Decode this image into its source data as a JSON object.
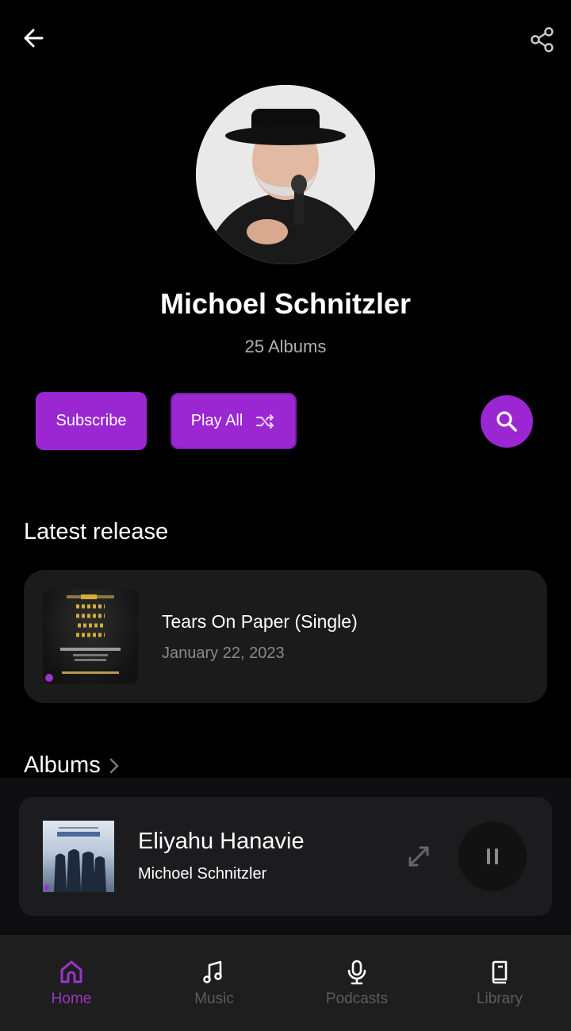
{
  "header": {
    "back_icon": "arrow-left-icon",
    "share_icon": "share-icon"
  },
  "artist": {
    "name": "Michoel Schnitzler",
    "album_count": "25 Albums"
  },
  "actions": {
    "subscribe_label": "Subscribe",
    "play_all_label": "Play All",
    "play_all_icon": "shuffle-icon",
    "search_icon": "search-icon"
  },
  "latest_release": {
    "section_title": "Latest release",
    "title": "Tears On Paper (Single)",
    "date": "January 22, 2023"
  },
  "albums": {
    "section_title": "Albums"
  },
  "now_playing": {
    "title": "Eliyahu Hanavie",
    "artist": "Michoel Schnitzler",
    "state": "playing"
  },
  "nav": {
    "items": [
      {
        "label": "Home",
        "icon": "home-icon",
        "active": true
      },
      {
        "label": "Music",
        "icon": "music-note-icon",
        "active": false
      },
      {
        "label": "Podcasts",
        "icon": "microphone-icon",
        "active": false
      },
      {
        "label": "Library",
        "icon": "book-icon",
        "active": false
      }
    ]
  },
  "colors": {
    "accent": "#9b27d3",
    "background": "#000000",
    "card": "#1b1b1b",
    "nav_bg": "#1e1e1e"
  }
}
